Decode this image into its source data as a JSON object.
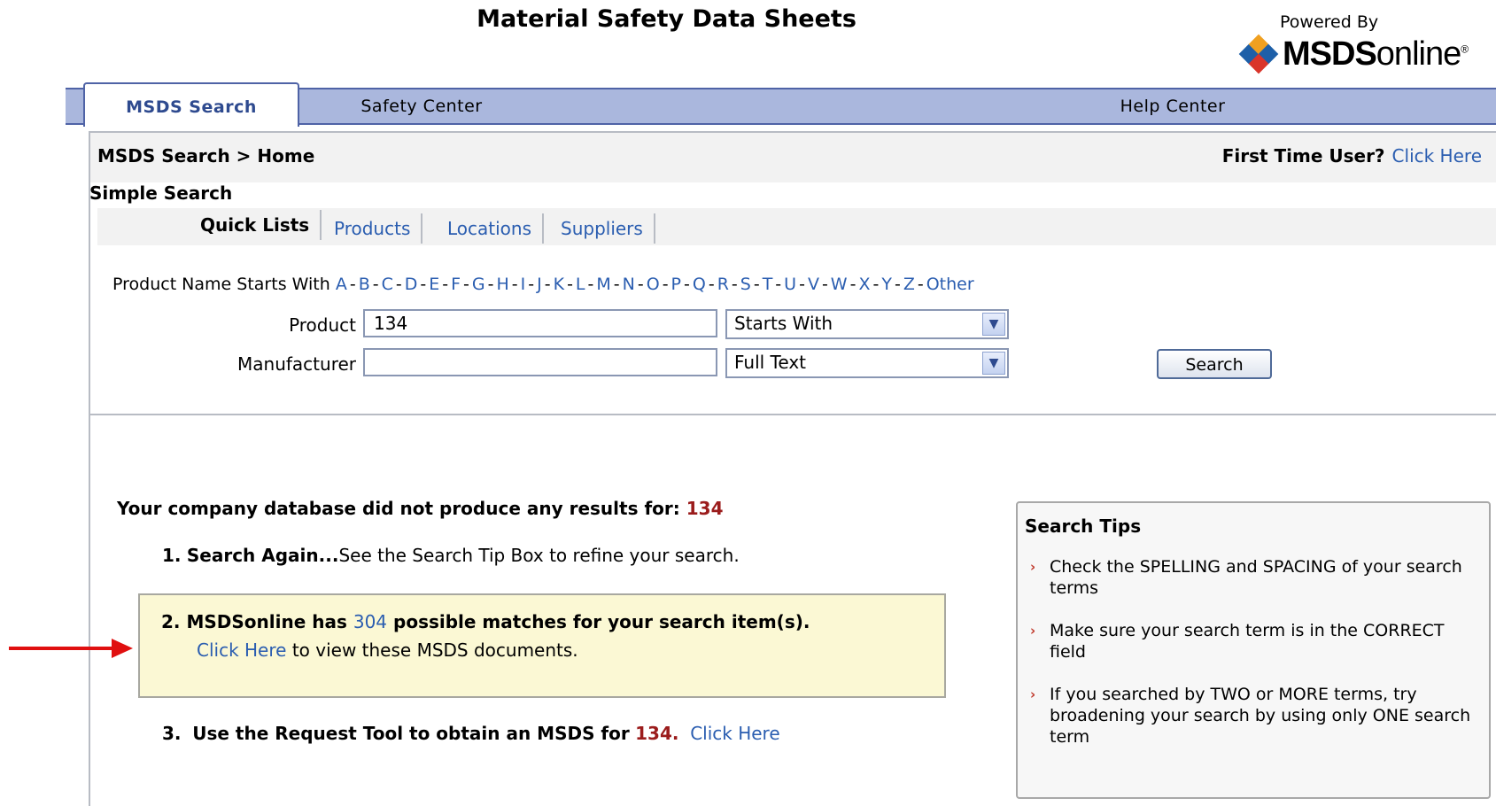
{
  "header": {
    "title": "Material Safety Data Sheets",
    "powered_by": "Powered By",
    "brand_logo": "MSDSonline"
  },
  "tabs": [
    {
      "label": "MSDS Search",
      "active": true
    },
    {
      "label": "Safety Center",
      "active": false
    },
    {
      "label": "Help Center",
      "active": false
    }
  ],
  "breadcrumb": "MSDS Search > Home",
  "first_time": {
    "question": "First Time User?",
    "link": "Click Here"
  },
  "simple_search": {
    "heading": "Simple Search",
    "subtabs": [
      "Quick Lists",
      "Products",
      "Locations",
      "Suppliers"
    ],
    "alpha_prefix": "Product Name Starts With",
    "letters": [
      "A",
      "B",
      "C",
      "D",
      "E",
      "F",
      "G",
      "H",
      "I",
      "J",
      "K",
      "L",
      "M",
      "N",
      "O",
      "P",
      "Q",
      "R",
      "S",
      "T",
      "U",
      "V",
      "W",
      "X",
      "Y",
      "Z",
      "Other"
    ],
    "product_label": "Product",
    "product_value": "134",
    "product_match": "Starts With",
    "manufacturer_label": "Manufacturer",
    "manufacturer_value": "",
    "manufacturer_match": "Full Text",
    "search_button": "Search"
  },
  "results": {
    "no_results_text": "Your company database did not produce any results for:",
    "query": "134",
    "step1_num": "1.",
    "step1_bold": "Search Again...",
    "step1_text": "See the Search Tip Box to refine your search.",
    "step2_num": "2.",
    "step2_pre": "MSDSonline has",
    "step2_count": "304",
    "step2_post": "possible matches for your search item(s).",
    "step2_link": "Click Here",
    "step2_rest": "to view these MSDS documents.",
    "step3_num": "3.",
    "step3_text": "Use the Request Tool to obtain an MSDS for",
    "step3_query": "134.",
    "step3_link": "Click Here"
  },
  "tips": {
    "title": "Search Tips",
    "items": [
      "Check the SPELLING and SPACING of your search terms",
      "Make sure your search term is in the CORRECT field",
      "If you searched by TWO or MORE terms, try broadening your search by using only ONE search term"
    ]
  },
  "colors": {
    "tab_bar": "#aab7dd",
    "link": "#2a5db0",
    "query_red": "#9b1c1c",
    "highlight_box": "#fbf8d4",
    "arrow": "#e01010"
  }
}
